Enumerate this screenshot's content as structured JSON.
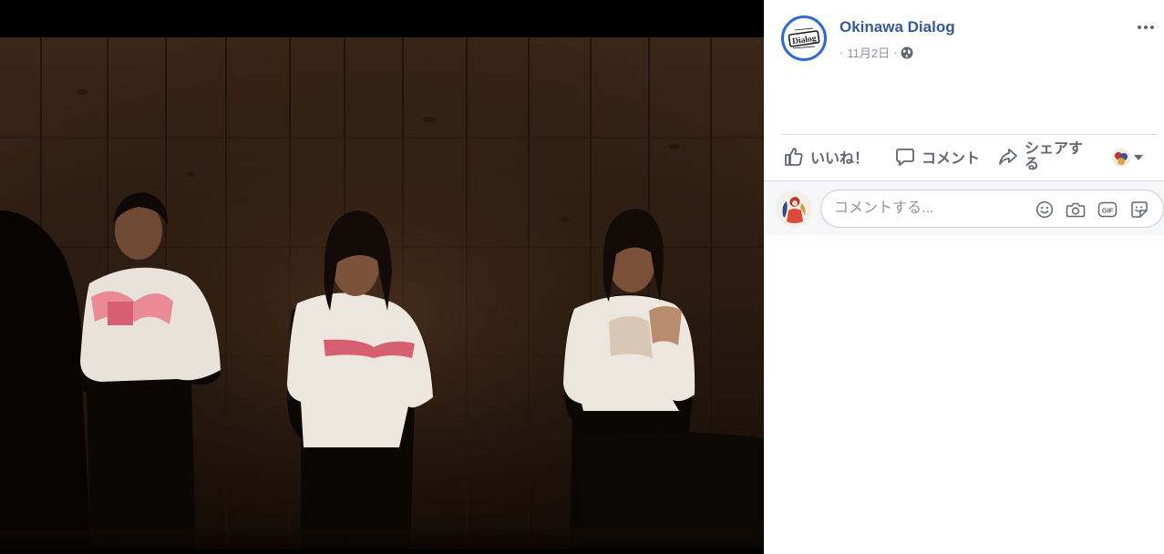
{
  "post": {
    "page_name": "Okinawa Dialog",
    "meta_separator": "·",
    "date": "11月2日",
    "audience_icon": "globe-icon"
  },
  "page_logo": {
    "text": "Dialog",
    "accent_color": "#2f6ad0"
  },
  "actions": {
    "like_label": "いいね！",
    "comment_label": "コメント",
    "share_label": "シェアする"
  },
  "comment_composer": {
    "placeholder": "コメントする...",
    "tools": [
      "emoji-icon",
      "camera-icon",
      "gif-icon",
      "sticker-icon"
    ],
    "gif_label": "GIF"
  },
  "colors": {
    "link": "#385898",
    "secondary_text": "#90949c",
    "action_text": "#606770",
    "divider": "#dadde1",
    "composer_bg": "#f5f6f7"
  }
}
